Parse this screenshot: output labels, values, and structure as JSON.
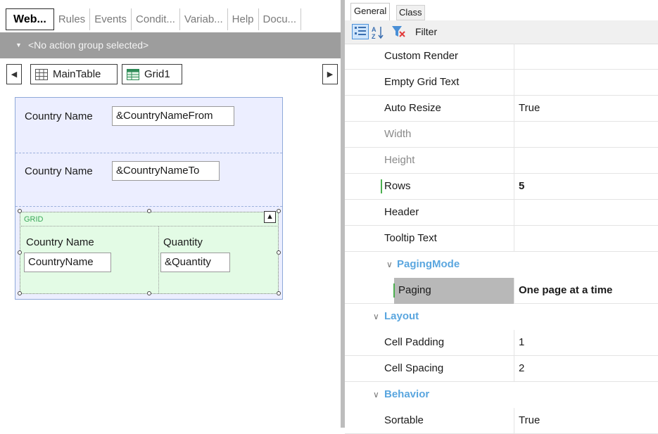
{
  "left_tabs": [
    "Web...",
    "Rules",
    "Events",
    "Condit...",
    "Variab...",
    "Help",
    "Docu..."
  ],
  "action_group": "<No action group selected>",
  "breadcrumb": {
    "main_table": "MainTable",
    "grid": "Grid1"
  },
  "form": {
    "row1": {
      "label": "Country Name",
      "field": "&CountryNameFrom"
    },
    "row2": {
      "label": "Country Name",
      "field": "&CountryNameTo"
    },
    "grid": {
      "tag": "GRID",
      "col1": {
        "header": "Country Name",
        "field": "CountryName"
      },
      "col2": {
        "header": "Quantity",
        "field": "&Quantity"
      }
    }
  },
  "properties": {
    "tabs": {
      "general": "General",
      "class": "Class"
    },
    "filter_label": "Filter",
    "rows": [
      {
        "name": "Custom Render",
        "value": ""
      },
      {
        "name": "Empty Grid Text",
        "value": ""
      },
      {
        "name": "Auto Resize",
        "value": "True"
      },
      {
        "name": "Width",
        "value": ""
      },
      {
        "name": "Height",
        "value": ""
      },
      {
        "name": "Rows",
        "value": "5"
      },
      {
        "name": "Header",
        "value": ""
      },
      {
        "name": "Tooltip Text",
        "value": ""
      }
    ],
    "paging_mode": {
      "title": "PagingMode",
      "name": "Paging",
      "value": "One page at a time"
    },
    "layout": {
      "title": "Layout",
      "rows": [
        {
          "name": "Cell Padding",
          "value": "1"
        },
        {
          "name": "Cell Spacing",
          "value": "2"
        }
      ]
    },
    "behavior": {
      "title": "Behavior",
      "rows": [
        {
          "name": "Sortable",
          "value": "True"
        }
      ]
    }
  }
}
